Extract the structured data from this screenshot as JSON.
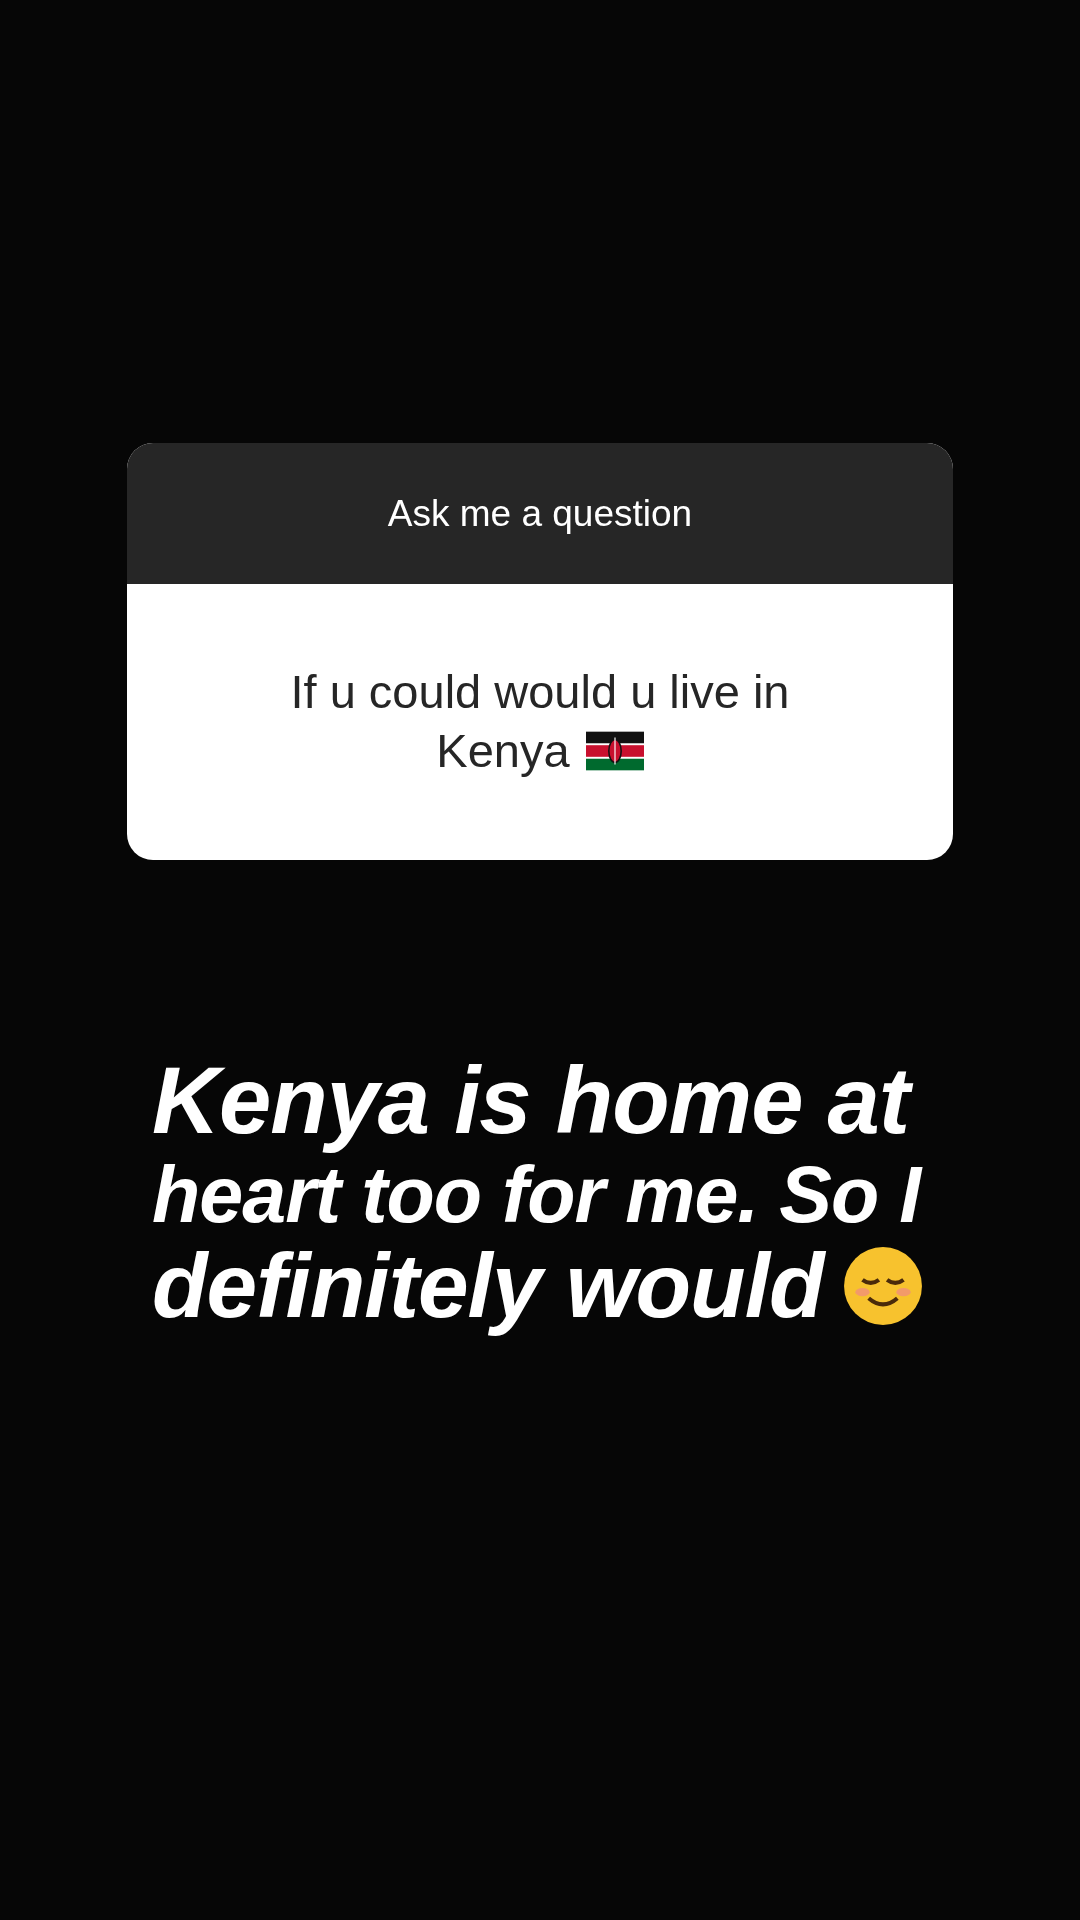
{
  "question_card": {
    "header": "Ask me a question",
    "question_lines": [
      "If u could would u live in",
      "Kenya"
    ]
  },
  "caption": {
    "lines": [
      "Kenya is home at",
      "heart too for me. So I",
      "definitely would"
    ]
  }
}
